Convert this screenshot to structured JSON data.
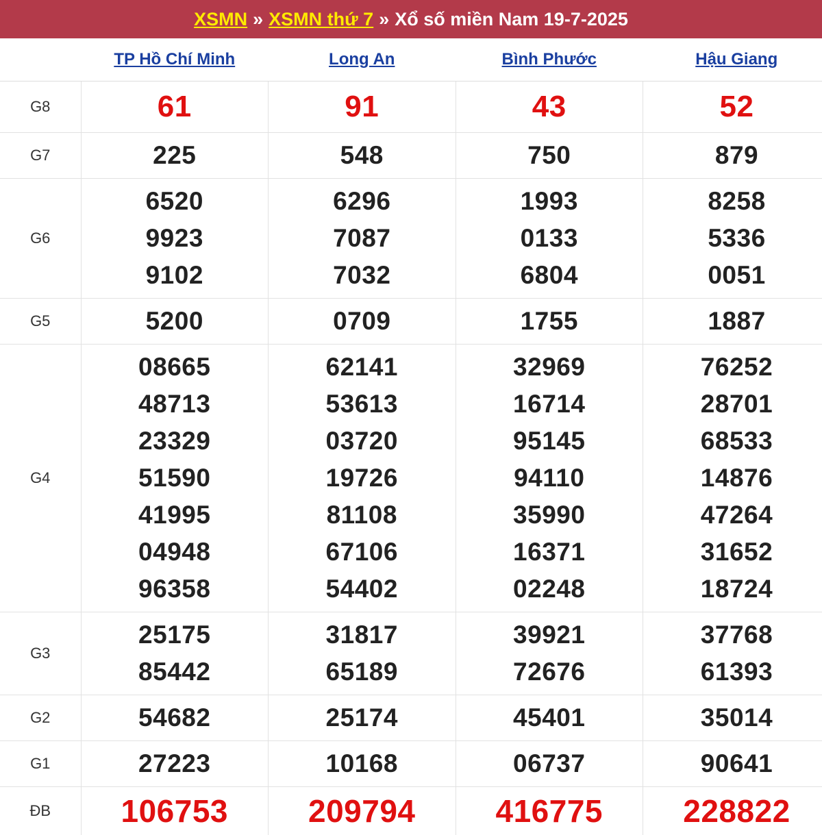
{
  "header": {
    "link1": "XSMN",
    "sep1": "»",
    "link2": "XSMN thứ 7",
    "sep2": "»",
    "title": "Xổ số miền Nam 19-7-2025"
  },
  "provinces": [
    "TP Hồ Chí Minh",
    "Long An",
    "Bình Phước",
    "Hậu Giang"
  ],
  "rows": [
    {
      "label": "G8",
      "cls": "g8",
      "values": [
        [
          "61"
        ],
        [
          "91"
        ],
        [
          "43"
        ],
        [
          "52"
        ]
      ]
    },
    {
      "label": "G7",
      "cls": "g7",
      "values": [
        [
          "225"
        ],
        [
          "548"
        ],
        [
          "750"
        ],
        [
          "879"
        ]
      ]
    },
    {
      "label": "G6",
      "cls": "g6",
      "values": [
        [
          "6520",
          "9923",
          "9102"
        ],
        [
          "6296",
          "7087",
          "7032"
        ],
        [
          "1993",
          "0133",
          "6804"
        ],
        [
          "8258",
          "5336",
          "0051"
        ]
      ]
    },
    {
      "label": "G5",
      "cls": "g5",
      "values": [
        [
          "5200"
        ],
        [
          "0709"
        ],
        [
          "1755"
        ],
        [
          "1887"
        ]
      ]
    },
    {
      "label": "G4",
      "cls": "g4",
      "values": [
        [
          "08665",
          "48713",
          "23329",
          "51590",
          "41995",
          "04948",
          "96358"
        ],
        [
          "62141",
          "53613",
          "03720",
          "19726",
          "81108",
          "67106",
          "54402"
        ],
        [
          "32969",
          "16714",
          "95145",
          "94110",
          "35990",
          "16371",
          "02248"
        ],
        [
          "76252",
          "28701",
          "68533",
          "14876",
          "47264",
          "31652",
          "18724"
        ]
      ]
    },
    {
      "label": "G3",
      "cls": "g3",
      "values": [
        [
          "25175",
          "85442"
        ],
        [
          "31817",
          "65189"
        ],
        [
          "39921",
          "72676"
        ],
        [
          "37768",
          "61393"
        ]
      ]
    },
    {
      "label": "G2",
      "cls": "g2",
      "values": [
        [
          "54682"
        ],
        [
          "25174"
        ],
        [
          "45401"
        ],
        [
          "35014"
        ]
      ]
    },
    {
      "label": "G1",
      "cls": "g1",
      "values": [
        [
          "27223"
        ],
        [
          "10168"
        ],
        [
          "06737"
        ],
        [
          "90641"
        ]
      ]
    },
    {
      "label": "ĐB",
      "cls": "db",
      "values": [
        [
          "106753"
        ],
        [
          "209794"
        ],
        [
          "416775"
        ],
        [
          "228822"
        ]
      ]
    }
  ]
}
